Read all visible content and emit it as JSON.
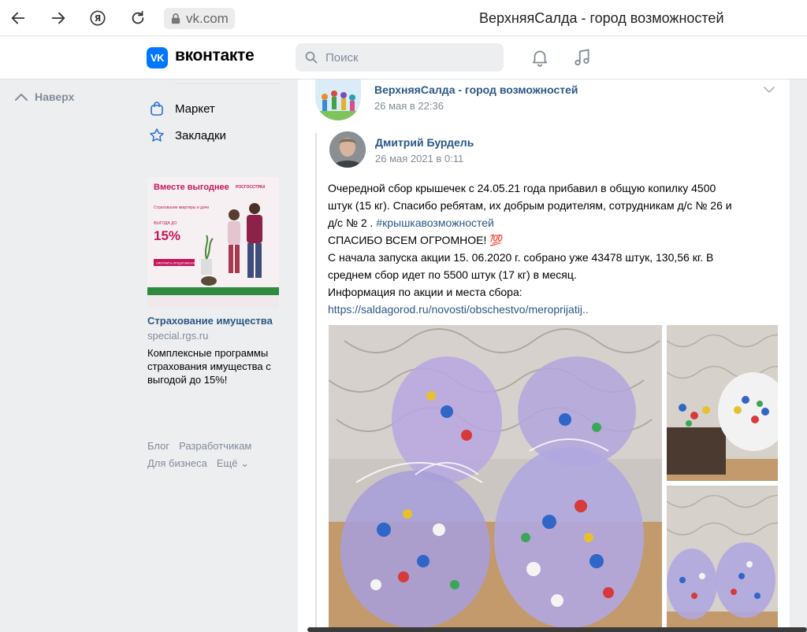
{
  "browser": {
    "url": "vk.com",
    "title": "ВерхняяСалда - город возможностей"
  },
  "header": {
    "logo_text": "VK",
    "wordmark": "вконтакте",
    "search_placeholder": "Поиск"
  },
  "left": {
    "back_to_top": "Наверх"
  },
  "sidebar": {
    "items": [
      {
        "label": "Маркет",
        "icon": "shopping-bag-icon"
      },
      {
        "label": "Закладки",
        "icon": "star-icon"
      }
    ],
    "ad": {
      "title": "Страхование имущества",
      "domain": "special.rgs.ru",
      "description": "Комплексные программы страхования имущества с выгодой до 15%!",
      "image_headline": "Вместе выгоднее",
      "image_brand": "РОСГОССТРАХ",
      "image_sub": "Страхование квартиры и дачи",
      "image_discount_label": "ВЫГОДА ДО",
      "image_discount": "15%",
      "image_button": "ОФОРМИТЬ ПРЕДЛОЖЕНИЕ"
    },
    "footer_links": [
      "Блог",
      "Разработчикам",
      "Для бизнеса",
      "Ещё ⌄"
    ]
  },
  "post": {
    "group_name": "ВерхняяСалда - город возможностей",
    "date": "26 мая в 22:36",
    "repost": {
      "author": "Дмитрий Бурдель",
      "date": "26 мая 2021 в 0:11",
      "text_lines": [
        "Очередной сбор крышечек с 24.05.21 года прибавил в общую копилку 4500",
        "штук (15 кг). Спасибо ребятам, их добрым родителям, сотрудникам д/с № 26 и",
        "д/с № 2 . "
      ],
      "hashtag": "#крышкавозможностей",
      "line_thanks": "СПАСИБО ВСЕМ ОГРОМНОЕ! 💯",
      "line_since_1": "С начала запуска акции 15. 06.2020 г. собрано уже 43478 штук, 130,56 кг. В",
      "line_since_2": "среднем сбор идет по 5500 штук (17 кг) в месяц.",
      "line_info": "Информация по акции и места сбора:",
      "link": "https://saldagorod.ru/novosti/obschestvo/meroprijatij.."
    }
  },
  "colors": {
    "vk_blue": "#0077ff",
    "link": "#2a5885",
    "muted": "#818c99",
    "page_bg": "#edeef0"
  }
}
